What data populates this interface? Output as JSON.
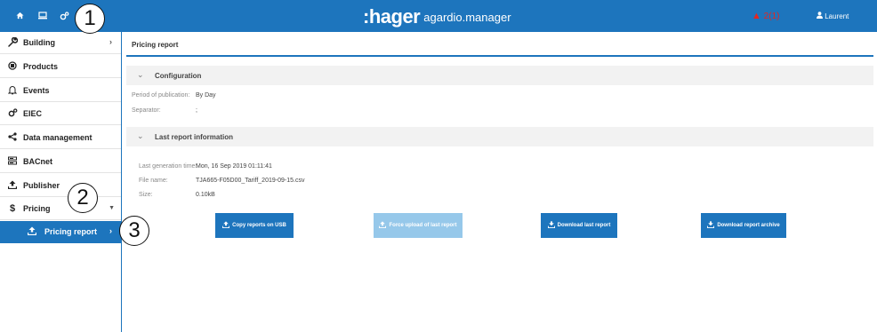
{
  "topbar": {
    "brand": ":hager",
    "product": "agardio.manager",
    "alert_count": "2(1)",
    "user": "Laurent",
    "icons": [
      "home-icon",
      "monitor-icon",
      "settings-icon"
    ]
  },
  "sidebar": {
    "items": [
      {
        "label": "Building",
        "icon": "wrench-icon"
      },
      {
        "label": "Products",
        "icon": "products-icon"
      },
      {
        "label": "Events",
        "icon": "bell-icon"
      },
      {
        "label": "EIEC",
        "icon": "gears-icon"
      },
      {
        "label": "Data management",
        "icon": "share-icon"
      },
      {
        "label": "BACnet",
        "icon": "server-icon"
      },
      {
        "label": "Publisher",
        "icon": "upload-icon"
      },
      {
        "label": "Pricing",
        "icon": "dollar-icon"
      }
    ],
    "sub_item": {
      "label": "Pricing report",
      "icon": "upload-icon"
    }
  },
  "callouts": [
    "1",
    "2",
    "3"
  ],
  "main": {
    "title": "Pricing report",
    "configuration": {
      "heading": "Configuration",
      "period_label": "Period of publication:",
      "period_value": "By Day",
      "separator_label": "Separator:",
      "separator_value": ";"
    },
    "last_report": {
      "heading": "Last report information",
      "gen_time_label": "Last generation time:",
      "gen_time_value": "Mon, 16 Sep 2019 01:11:41",
      "file_label": "File name:",
      "file_value": "TJA665-F05D00_Tariff_2019-09-15.csv",
      "size_label": "Size:",
      "size_value": "0.10kB"
    },
    "buttons": {
      "copy_usb": "Copy reports on USB",
      "force_upload": "Force upload of last report",
      "download_last": "Download last report",
      "download_archive": "Download report archive"
    }
  },
  "colors": {
    "primary": "#1d75bd",
    "disabled": "#96c8ea",
    "alert": "#e5261f"
  }
}
